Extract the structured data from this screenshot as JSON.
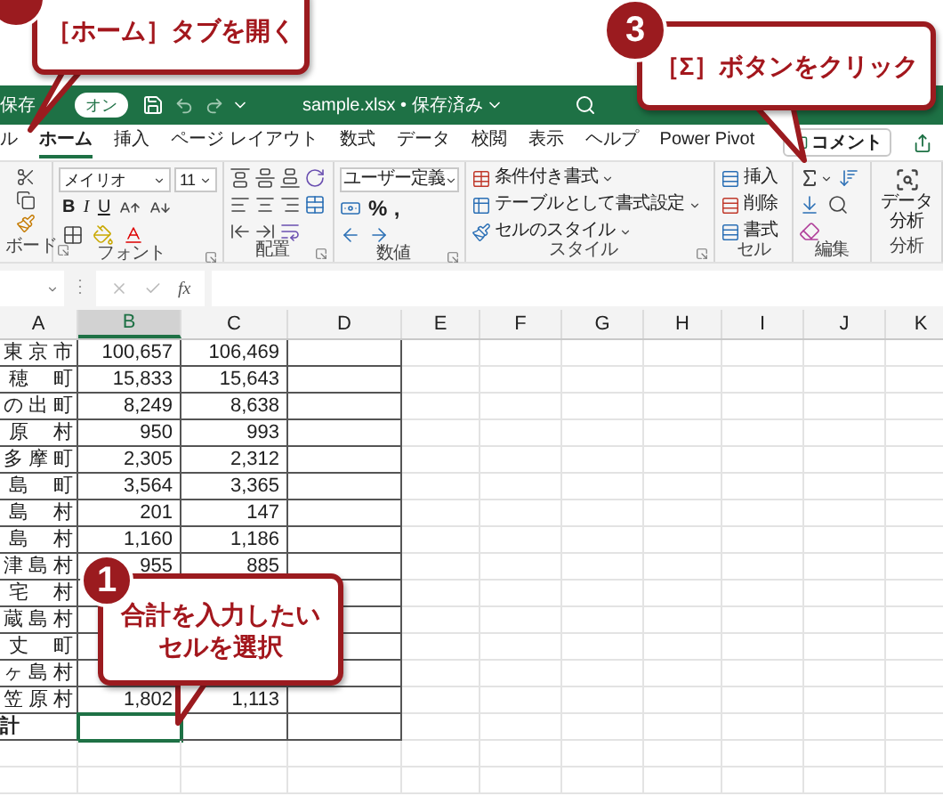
{
  "title_bar": {
    "autosave_label": "保存",
    "autosave_toggle": {
      "label": "オン",
      "on": true
    },
    "filename": "sample.xlsx • 保存済み"
  },
  "tabs": [
    {
      "label": "ル",
      "selected": false
    },
    {
      "label": "ホーム",
      "selected": true
    },
    {
      "label": "挿入",
      "selected": false
    },
    {
      "label": "ページ レイアウト",
      "selected": false
    },
    {
      "label": "数式",
      "selected": false
    },
    {
      "label": "データ",
      "selected": false
    },
    {
      "label": "校閲",
      "selected": false
    },
    {
      "label": "表示",
      "selected": false
    },
    {
      "label": "ヘルプ",
      "selected": false
    },
    {
      "label": "Power Pivot",
      "selected": false
    }
  ],
  "comment_button": "コメント",
  "ribbon": {
    "clipboard": {
      "label": "ボード"
    },
    "font": {
      "name": "メイリオ",
      "size": "11",
      "styles": [
        "B",
        "I",
        "U"
      ],
      "label": "フォント"
    },
    "alignment": {
      "label": "配置"
    },
    "number": {
      "format": "ユーザー定義",
      "symbols": [
        "%",
        ","
      ],
      "label": "数値"
    },
    "styles": {
      "items": [
        "条件付き書式",
        "テーブルとして書式設定",
        "セルのスタイル"
      ],
      "label": "スタイル"
    },
    "cells": {
      "items": [
        "挿入",
        "削除",
        "書式"
      ],
      "label": "セル"
    },
    "editing": {
      "label": "編集"
    },
    "analysis": {
      "button": "データ分析",
      "label": "分析"
    }
  },
  "formula_bar": {
    "separator": "⋮",
    "function_label": "fx"
  },
  "columns": [
    {
      "label": "A",
      "selected": false
    },
    {
      "label": "B",
      "selected": true
    },
    {
      "label": "C",
      "selected": false
    },
    {
      "label": "D",
      "selected": false
    },
    {
      "label": "E",
      "selected": false
    },
    {
      "label": "F",
      "selected": false
    },
    {
      "label": "G",
      "selected": false
    },
    {
      "label": "H",
      "selected": false
    },
    {
      "label": "I",
      "selected": false
    },
    {
      "label": "J",
      "selected": false
    },
    {
      "label": "K",
      "selected": false
    }
  ],
  "rows": [
    {
      "cells": [
        "東 京 市",
        "100,657",
        "106,469"
      ],
      "selected": false
    },
    {
      "cells": [
        "穂　 町",
        "15,833",
        "15,643"
      ],
      "selected": false
    },
    {
      "cells": [
        "の 出 町",
        "8,249",
        "8,638"
      ],
      "selected": false
    },
    {
      "cells": [
        "原　 村",
        "950",
        "993"
      ],
      "selected": false
    },
    {
      "cells": [
        "多 摩 町",
        "2,305",
        "2,312"
      ],
      "selected": false
    },
    {
      "cells": [
        "島　 町",
        "3,564",
        "3,365"
      ],
      "selected": false
    },
    {
      "cells": [
        "島　 村",
        "201",
        "147"
      ],
      "selected": false
    },
    {
      "cells": [
        "島　 村",
        "1,160",
        "1,186"
      ],
      "selected": false
    },
    {
      "cells": [
        "津 島 村",
        "955",
        "885"
      ],
      "selected": false
    },
    {
      "cells": [
        "宅　 村"
      ],
      "selected": false
    },
    {
      "cells": [
        "蔵 島 村"
      ],
      "selected": false
    },
    {
      "cells": [
        "丈　 町"
      ],
      "selected": false
    },
    {
      "cells": [
        "ヶ 島 村"
      ],
      "selected": false
    },
    {
      "cells": [
        "笠 原 村",
        "1,802",
        "1,113"
      ],
      "selected": false
    },
    {
      "cells": [
        "計"
      ],
      "selected": true
    }
  ],
  "callouts": [
    {
      "text": "［ホーム］タブを開く"
    },
    {
      "number": "3",
      "text": "［Σ］ボタンをクリック"
    },
    {
      "number": "1",
      "text": "合計を入力したいセルを選択"
    }
  ]
}
